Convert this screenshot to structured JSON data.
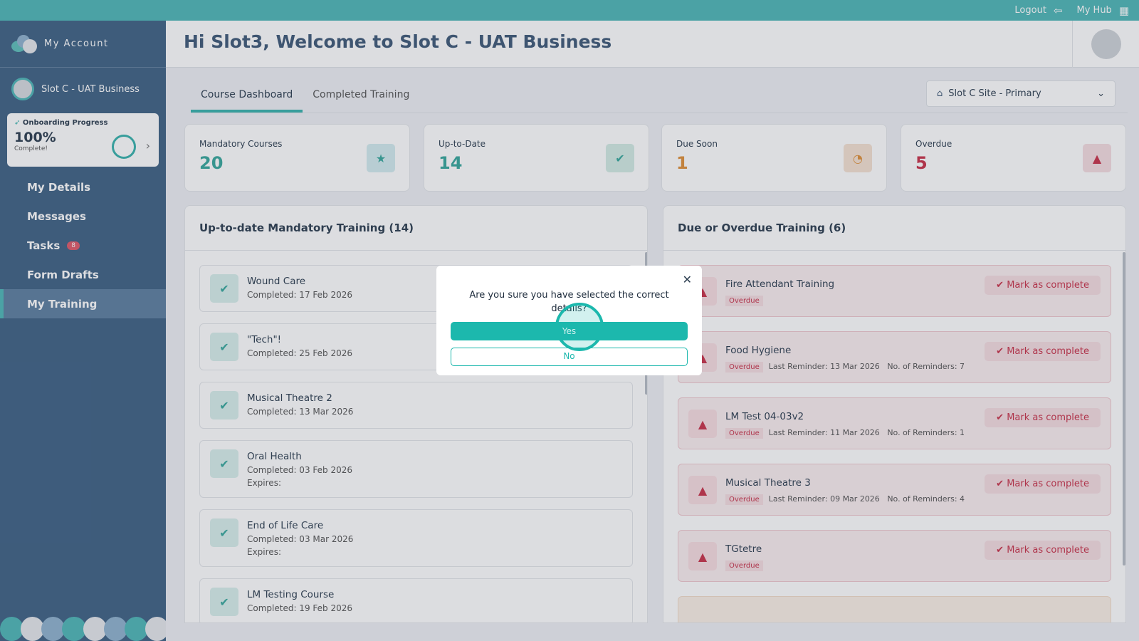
{
  "topbar": {
    "logout": "Logout",
    "my_hub": "My Hub"
  },
  "sidebar": {
    "account": "My Account",
    "business": "Slot C - UAT Business",
    "onboarding": {
      "title": "Onboarding Progress",
      "percent": "100%",
      "status": "Complete!",
      "progress": 1.0
    },
    "nav": [
      {
        "label": "My Details"
      },
      {
        "label": "Messages"
      },
      {
        "label": "Tasks",
        "badge": "8"
      },
      {
        "label": "Form Drafts"
      },
      {
        "label": "My Training"
      }
    ]
  },
  "header": {
    "title": "Hi Slot3, Welcome to Slot C - UAT Business"
  },
  "tabs": [
    "Course Dashboard",
    "Completed Training"
  ],
  "site_select": {
    "value": "Slot C Site - Primary"
  },
  "stats": [
    {
      "label": "Mandatory Courses",
      "value": "20",
      "color": "#38a89d"
    },
    {
      "label": "Up-to-Date",
      "value": "14",
      "color": "#38a89d"
    },
    {
      "label": "Due Soon",
      "value": "1",
      "color": "#e0913a"
    },
    {
      "label": "Overdue",
      "value": "5",
      "color": "#c8324a"
    }
  ],
  "uptodate": {
    "title": "Up-to-date Mandatory Training (14)",
    "items": [
      {
        "name": "Wound Care",
        "completed": "Completed: 17 Feb 2026"
      },
      {
        "name": "\"Tech\"!",
        "completed": "Completed: 25 Feb 2026"
      },
      {
        "name": "Musical Theatre 2",
        "completed": "Completed: 13 Mar 2026"
      },
      {
        "name": "Oral Health",
        "completed": "Completed: 03 Feb 2026",
        "expires": "Expires:"
      },
      {
        "name": "End of Life Care",
        "completed": "Completed: 03 Mar 2026",
        "expires": "Expires:"
      },
      {
        "name": "LM Testing Course",
        "completed": "Completed: 19 Feb 2026"
      }
    ]
  },
  "due": {
    "title": "Due or Overdue Training (6)",
    "mark_label": "Mark as complete",
    "items": [
      {
        "name": "Fire Attendant Training",
        "status": "Overdue"
      },
      {
        "name": "Food Hygiene",
        "status": "Overdue",
        "last": "Last Reminder: 13 Mar 2026",
        "count": "No. of Reminders: 7"
      },
      {
        "name": "LM Test 04-03v2",
        "status": "Overdue",
        "last": "Last Reminder: 11 Mar 2026",
        "count": "No. of Reminders: 1"
      },
      {
        "name": "Musical Theatre 3",
        "status": "Overdue",
        "last": "Last Reminder: 09 Mar 2026",
        "count": "No. of Reminders: 4"
      },
      {
        "name": "TGtetre",
        "status": "Overdue"
      }
    ]
  },
  "modal": {
    "question": "Are you sure you have selected the correct details?",
    "yes": "Yes",
    "no": "No"
  }
}
